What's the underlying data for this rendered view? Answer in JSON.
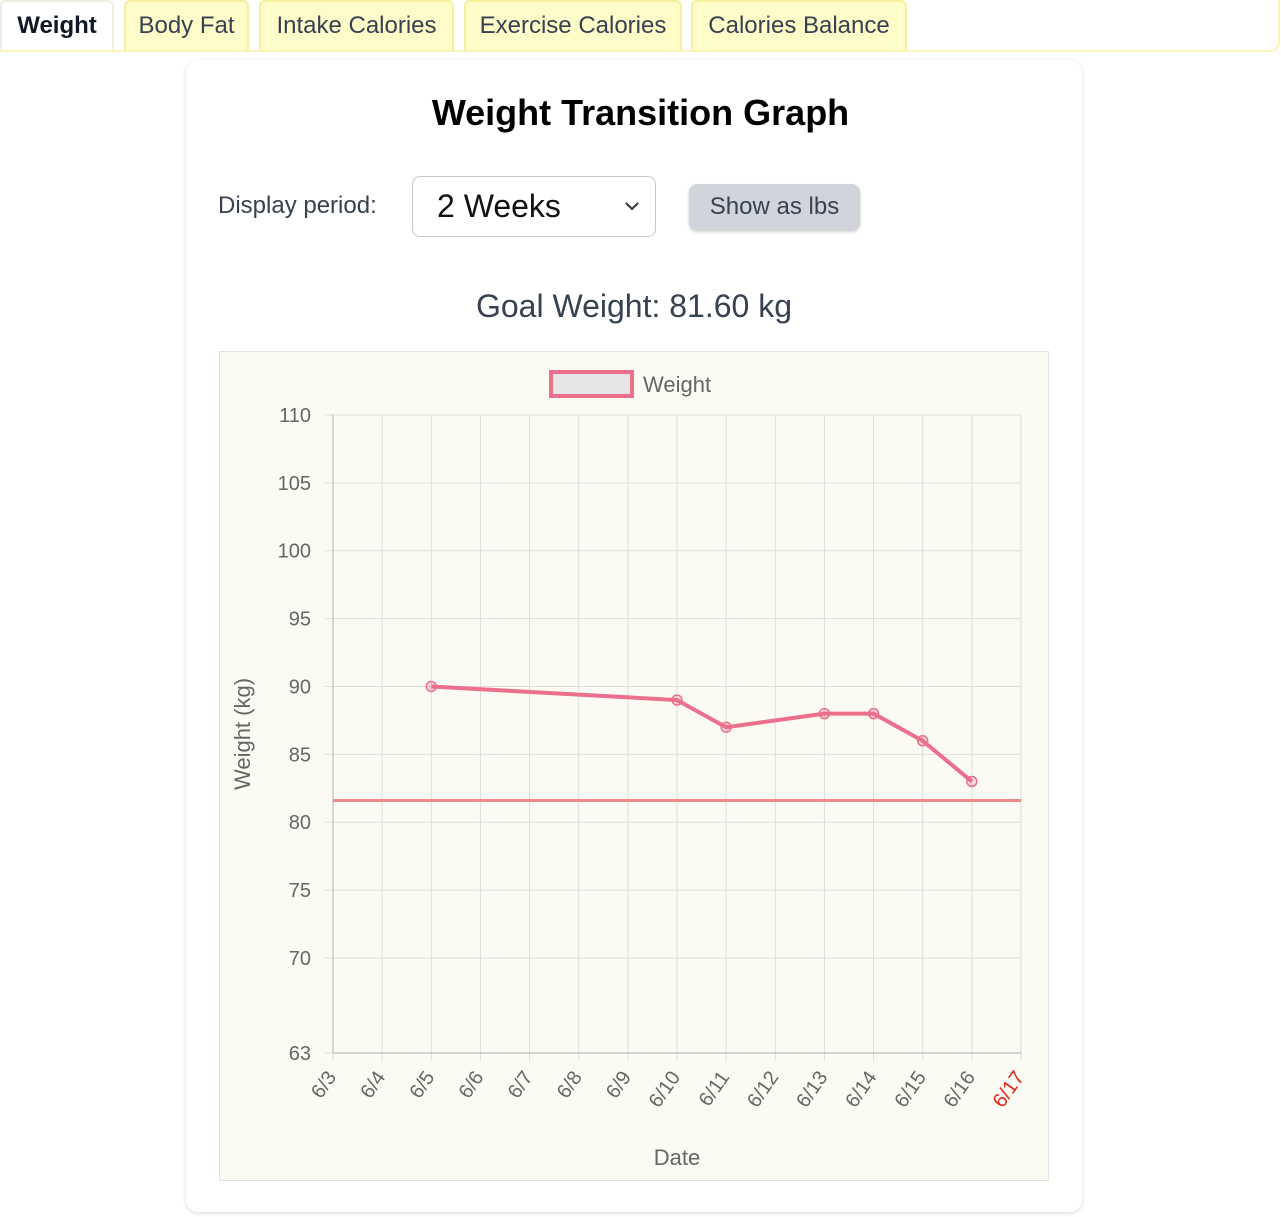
{
  "tabs": [
    {
      "label": "Weight",
      "active": true
    },
    {
      "label": "Body Fat",
      "active": false
    },
    {
      "label": "Intake Calories",
      "active": false
    },
    {
      "label": "Exercise Calories",
      "active": false
    },
    {
      "label": "Calories Balance",
      "active": false
    }
  ],
  "card": {
    "title": "Weight Transition Graph",
    "period_label": "Display period:",
    "period_value": "2 Weeks",
    "lbs_button": "Show as lbs",
    "goal_text": "Goal Weight: 81.60 kg"
  },
  "icons": {
    "select_arrow": "chevron-down-icon"
  },
  "colors": {
    "tab_bg": "#fefcc8",
    "line": "#ec6f8c",
    "goal_line": "#f08a8a",
    "today_label": "#e0241b",
    "chart_bg": "#fbfbf4"
  },
  "chart_data": {
    "type": "line",
    "legend": "Weight",
    "legend_position": "top",
    "xlabel": "Date",
    "ylabel": "Weight (kg)",
    "categories": [
      "6/3",
      "6/4",
      "6/5",
      "6/6",
      "6/7",
      "6/8",
      "6/9",
      "6/10",
      "6/11",
      "6/12",
      "6/13",
      "6/14",
      "6/15",
      "6/16",
      "6/17"
    ],
    "highlight_category": "6/17",
    "yticks": [
      63,
      70,
      75,
      80,
      85,
      90,
      95,
      100,
      105,
      110
    ],
    "ylim": [
      63,
      110
    ],
    "series": [
      {
        "name": "Weight",
        "points": [
          {
            "x": "6/5",
            "y": 90
          },
          {
            "x": "6/10",
            "y": 89
          },
          {
            "x": "6/11",
            "y": 87
          },
          {
            "x": "6/13",
            "y": 88
          },
          {
            "x": "6/14",
            "y": 88
          },
          {
            "x": "6/15",
            "y": 86
          },
          {
            "x": "6/16",
            "y": 83
          }
        ]
      }
    ],
    "goal_line": 81.6,
    "grid": true
  }
}
